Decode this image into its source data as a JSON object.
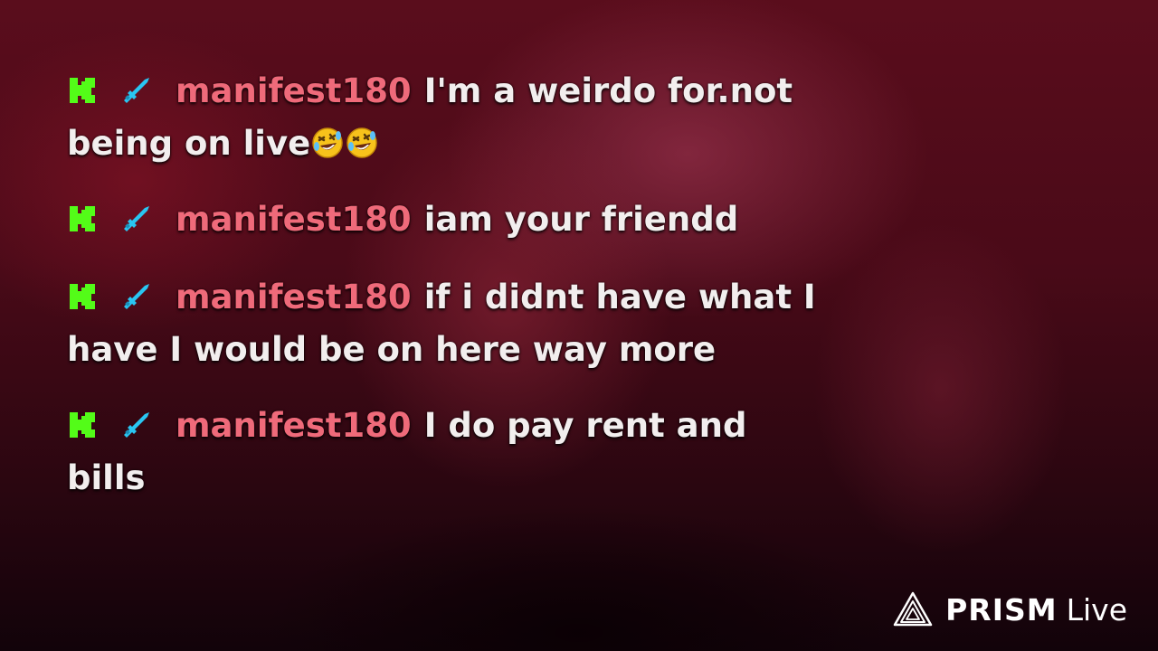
{
  "overlay": {
    "messages": [
      {
        "username": "manifest180",
        "text": "I'm a weirdo for.not being on live",
        "emoji": [
          "rolling-on-floor-laughing",
          "rolling-on-floor-laughing"
        ]
      },
      {
        "username": "manifest180",
        "text": "iam your friendd"
      },
      {
        "username": "manifest180",
        "text": "if i didnt have what I have I would be on here way more"
      },
      {
        "username": "manifest180",
        "text": "I do pay rent and bills"
      }
    ],
    "badges": [
      "kick-logo-icon",
      "sword-icon"
    ],
    "colors": {
      "username": "#ef6a7a",
      "message_text": "#f2eeee",
      "kick_badge": "#53fc18",
      "sword_badge": "#29c6f2"
    }
  },
  "branding": {
    "logo": "prism-logo-icon",
    "name": "PRISM",
    "suffix": "Live"
  }
}
